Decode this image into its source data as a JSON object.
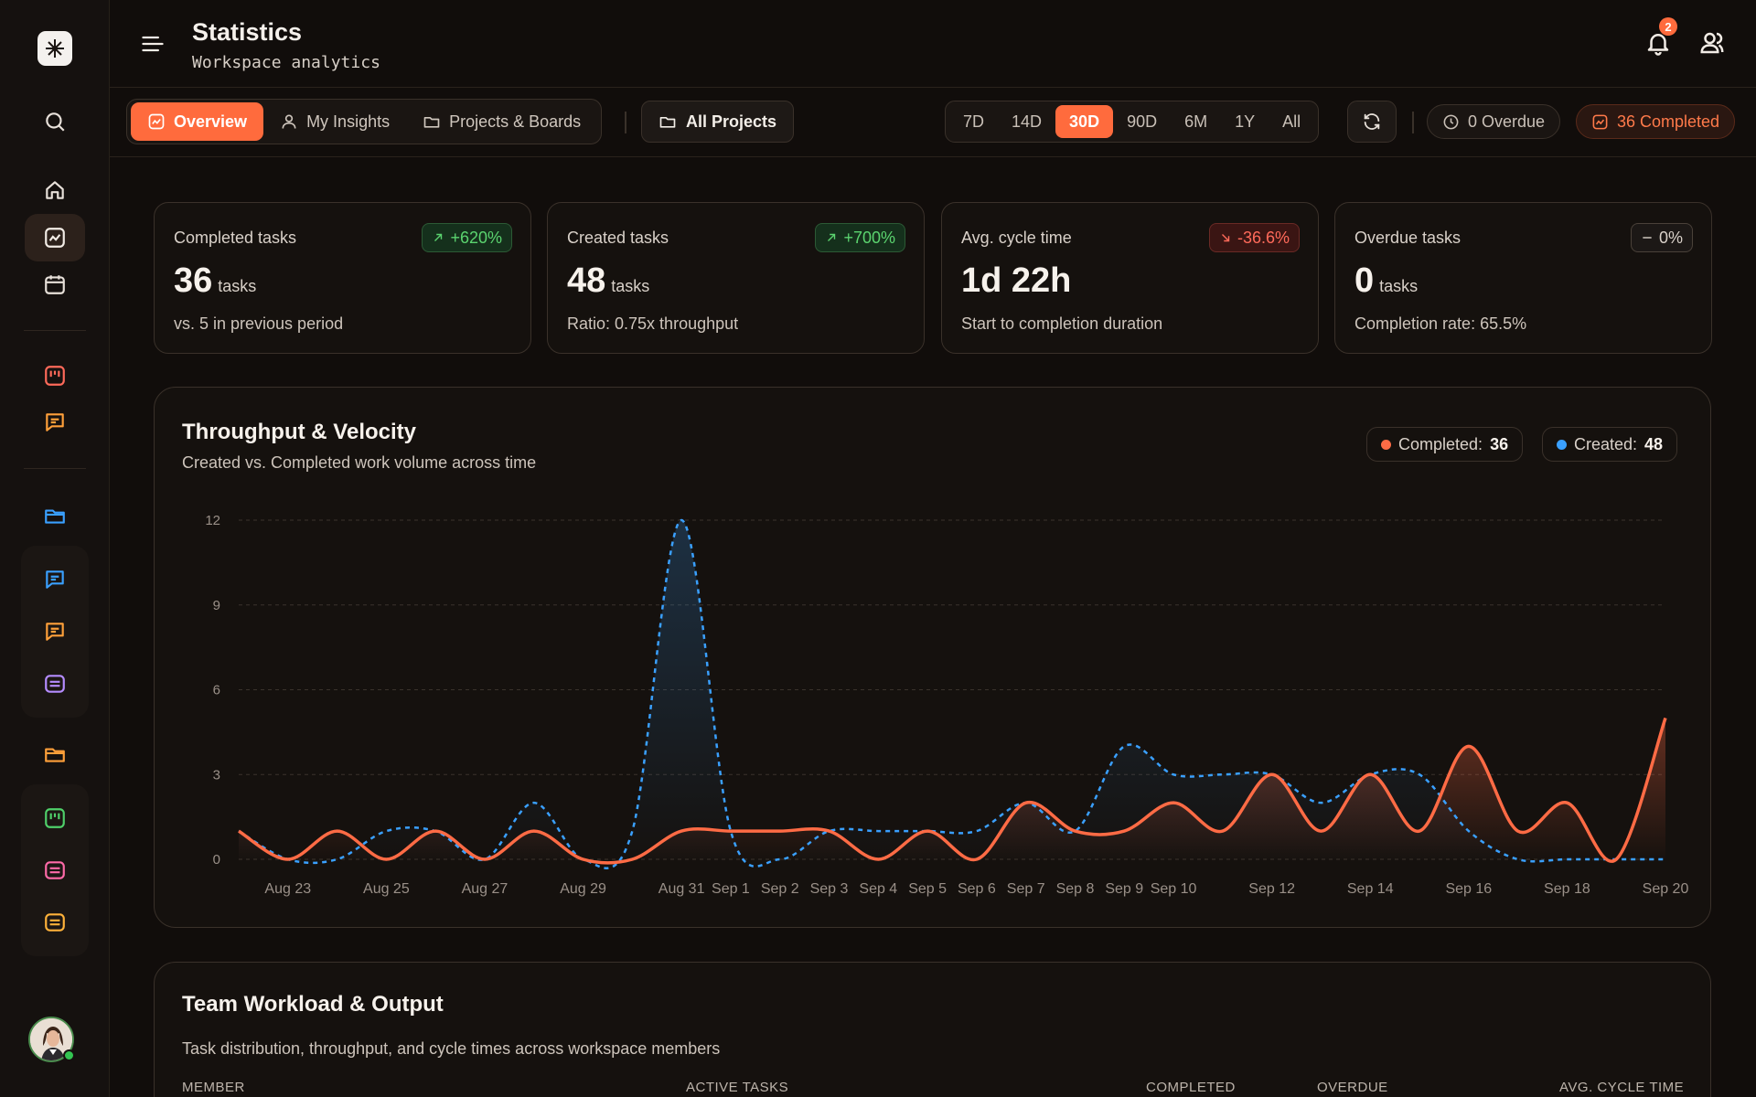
{
  "header": {
    "title": "Statistics",
    "subtitle": "Workspace analytics",
    "notification_count": "2"
  },
  "sidebar": {
    "items": [
      {
        "icon": "search-icon"
      },
      {
        "icon": "home-icon"
      },
      {
        "icon": "analytics-icon"
      },
      {
        "icon": "calendar-icon"
      },
      {
        "icon": "board-icon"
      },
      {
        "icon": "chat-icon"
      },
      {
        "icon": "folder-icon"
      },
      {
        "icon": "chat-icon"
      },
      {
        "icon": "chat-icon"
      },
      {
        "icon": "list-icon"
      },
      {
        "icon": "folder-icon"
      },
      {
        "icon": "board-icon"
      },
      {
        "icon": "list-icon"
      },
      {
        "icon": "list-icon"
      }
    ]
  },
  "toolbar": {
    "tabs": [
      {
        "label": "Overview",
        "icon": "chart-icon"
      },
      {
        "label": "My Insights",
        "icon": "user-icon"
      },
      {
        "label": "Projects & Boards",
        "icon": "folder-icon"
      }
    ],
    "project_filter": "All Projects",
    "ranges": [
      "7D",
      "14D",
      "30D",
      "90D",
      "6M",
      "1Y",
      "All"
    ],
    "selected_range": "30D",
    "overdue_pill": "0 Overdue",
    "completed_pill": "36 Completed"
  },
  "kpis": [
    {
      "label": "Completed tasks",
      "badge": "+620%",
      "badge_icon": "trend-up-icon",
      "value": "36",
      "unit": "tasks",
      "note": "vs. 5 in previous period"
    },
    {
      "label": "Created tasks",
      "badge": "+700%",
      "badge_icon": "trend-up-icon",
      "value": "48",
      "unit": "tasks",
      "note": "Ratio: 0.75x throughput"
    },
    {
      "label": "Avg. cycle time",
      "badge": "-36.6%",
      "badge_icon": "trend-down-icon",
      "value": "1d 22h",
      "unit": "",
      "note": "Start to completion duration"
    },
    {
      "label": "Overdue tasks",
      "badge": "0%",
      "badge_icon": "dash-icon",
      "value": "0",
      "unit": "tasks",
      "note": "Completion rate: 65.5%"
    }
  ],
  "throughput": {
    "title": "Throughput & Velocity",
    "subtitle": "Created vs. Completed work volume across time",
    "legend_completed_label": "Completed:",
    "legend_completed_value": "36",
    "legend_created_label": "Created:",
    "legend_created_value": "48"
  },
  "chart_data": {
    "type": "line",
    "x": [
      "Aug 22",
      "Aug 23",
      "Aug 24",
      "Aug 25",
      "Aug 26",
      "Aug 27",
      "Aug 28",
      "Aug 29",
      "Aug 30",
      "Aug 31",
      "Sep 1",
      "Sep 2",
      "Sep 3",
      "Sep 4",
      "Sep 5",
      "Sep 6",
      "Sep 7",
      "Sep 8",
      "Sep 9",
      "Sep 10",
      "Sep 11",
      "Sep 12",
      "Sep 13",
      "Sep 14",
      "Sep 15",
      "Sep 16",
      "Sep 17",
      "Sep 18",
      "Sep 19",
      "Sep 20"
    ],
    "x_tick_labels": [
      "Aug 23",
      "Aug 25",
      "Aug 27",
      "Aug 29",
      "Aug 31",
      "Sep 1",
      "Sep 2",
      "Sep 3",
      "Sep 4",
      "Sep 5",
      "Sep 6",
      "Sep 7",
      "Sep 8",
      "Sep 9",
      "Sep 10",
      "Sep 12",
      "Sep 14",
      "Sep 16",
      "Sep 18",
      "Sep 20"
    ],
    "y_ticks": [
      0,
      3,
      6,
      9,
      12
    ],
    "ylim": [
      0,
      12
    ],
    "grid": true,
    "series": [
      {
        "name": "Completed",
        "color": "#ff6b45",
        "style": "solid",
        "values": [
          1,
          0,
          1,
          0,
          1,
          0,
          1,
          0,
          0,
          1,
          1,
          1,
          1,
          0,
          1,
          0,
          2,
          1,
          1,
          2,
          1,
          3,
          1,
          3,
          1,
          4,
          1,
          2,
          0,
          5
        ]
      },
      {
        "name": "Created",
        "color": "#3aa0ff",
        "style": "dashed",
        "values": [
          1,
          0,
          0,
          1,
          1,
          0,
          2,
          0,
          1,
          12,
          1,
          0,
          1,
          1,
          1,
          1,
          2,
          1,
          4,
          3,
          3,
          3,
          2,
          3,
          3,
          1,
          0,
          0,
          0,
          0
        ]
      }
    ]
  },
  "team": {
    "title": "Team Workload & Output",
    "subtitle": "Task distribution, throughput, and cycle times across workspace members",
    "columns": [
      "MEMBER",
      "ACTIVE TASKS",
      "COMPLETED",
      "OVERDUE",
      "AVG. CYCLE TIME"
    ]
  }
}
